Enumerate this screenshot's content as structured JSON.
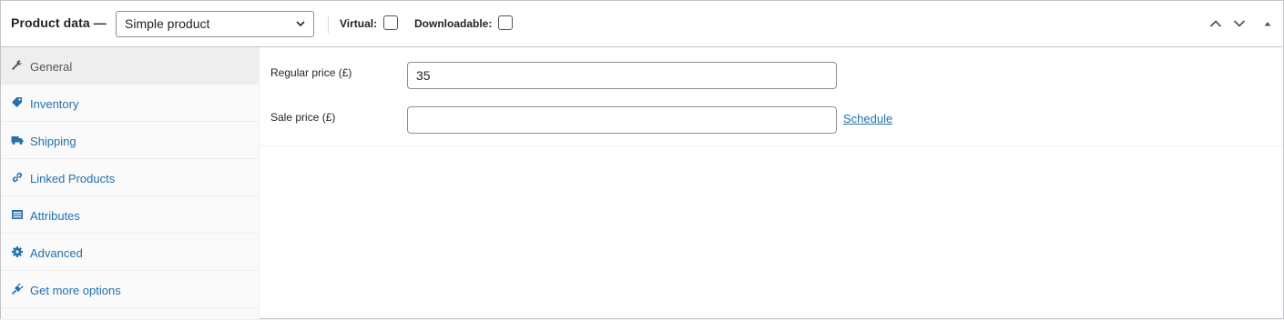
{
  "header": {
    "title": "Product data —",
    "product_type": "Simple product",
    "virtual_label": "Virtual:",
    "downloadable_label": "Downloadable:"
  },
  "tabs": [
    {
      "label": "General",
      "icon": "wrench-icon",
      "active": true
    },
    {
      "label": "Inventory",
      "icon": "tag-icon"
    },
    {
      "label": "Shipping",
      "icon": "truck-icon"
    },
    {
      "label": "Linked Products",
      "icon": "link-icon"
    },
    {
      "label": "Attributes",
      "icon": "list-table-icon"
    },
    {
      "label": "Advanced",
      "icon": "gear-icon"
    },
    {
      "label": "Get more options",
      "icon": "plugin-icon"
    }
  ],
  "general": {
    "regular_price_label": "Regular price (£)",
    "regular_price_value": "35",
    "sale_price_label": "Sale price (£)",
    "sale_price_value": "",
    "schedule_link": "Schedule"
  },
  "colors": {
    "link": "#2271b1",
    "active_tab_bg": "#eeeeee",
    "border": "#c3c4c7"
  }
}
